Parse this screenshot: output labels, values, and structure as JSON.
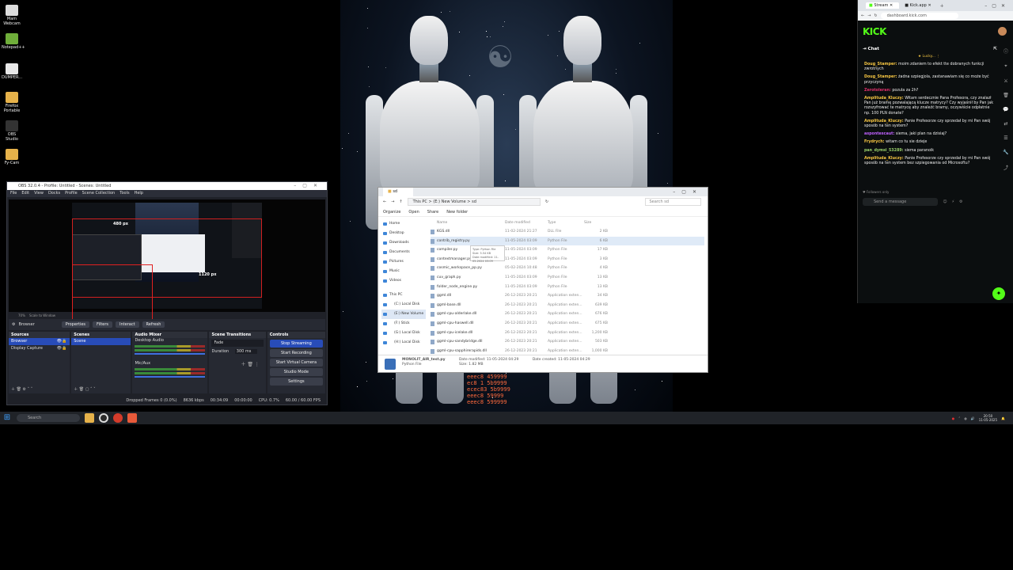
{
  "desktop": {
    "icons": [
      {
        "label": "Mam\nWebcam",
        "color": "#dcdcdc"
      },
      {
        "label": "Notepad++",
        "color": "#6fae3a"
      },
      {
        "label": "DUMPER...",
        "color": "#e8e8e8"
      },
      {
        "label": "Firefox Portable",
        "color": "#e6b24a"
      },
      {
        "label": "OBS Studio",
        "color": "#333333"
      },
      {
        "label": "Fy-Cam",
        "color": "#e6b24a"
      }
    ]
  },
  "wallpaper": {
    "hex_lines": [
      "eeec8 459999",
      "ec8 1 5b9999",
      "ecec83 5b9999",
      "eeec8 59999",
      "eeec8 599999"
    ]
  },
  "obs": {
    "title": "OBS 32.0.4 - Profile: Untitled - Scenes: Untitled",
    "menu": [
      "File",
      "Edit",
      "View",
      "Docks",
      "Profile",
      "Scene Collection",
      "Tools",
      "Help"
    ],
    "dim_top": "480 px",
    "dim_right": "1120 px",
    "zoom_label": "70%",
    "zoom_mode": "Scale to Window",
    "source_bar": {
      "current": "Browser",
      "buttons": [
        "Properties",
        "Filters",
        "Interact",
        "Refresh"
      ]
    },
    "sources": {
      "title": "Sources",
      "items": [
        "Browser",
        "Display Capture"
      ]
    },
    "scenes": {
      "title": "Scenes",
      "items": [
        "Scene"
      ]
    },
    "audio": {
      "title": "Audio Mixer",
      "channels": [
        "Desktop Audio",
        "Mic/Aux"
      ]
    },
    "transitions": {
      "title": "Scene Transitions",
      "type": "Fade",
      "duration_label": "Duration",
      "duration_value": "300 ms"
    },
    "controls": {
      "title": "Controls",
      "buttons": [
        "Stop Streaming",
        "Start Recording",
        "Start Virtual Camera",
        "Studio Mode",
        "Settings"
      ]
    },
    "status": {
      "dropped": "Dropped Frames 0 (0.0%)",
      "bitrate": "8636 kbps",
      "stream_time": "00:34:09",
      "rec_time": "00:00:00",
      "cpu": "CPU: 0.7%",
      "fps": "60.00 / 60.00 FPS"
    }
  },
  "explorer": {
    "tab": "sd",
    "breadcrumb": "This PC  >  (E:) New Volume  >  sd",
    "search_placeholder": "Search sd",
    "toolbar": [
      "Organize",
      "Open",
      "Share",
      "New folder"
    ],
    "nav": [
      "Home",
      "Desktop",
      "Downloads",
      "Documents",
      "Pictures",
      "Music",
      "Videos",
      "This PC",
      "(C:) Local Disk",
      "(E:) New Volume",
      "(F:) Stick",
      "(G:) Local Disk",
      "(H:) Local Disk"
    ],
    "columns": [
      "Name",
      "Date modified",
      "Type",
      "Size"
    ],
    "files": [
      {
        "name": "KGS.dll",
        "date": "11-02-2024 21:27",
        "type": "DLL File",
        "size": "2 KB"
      },
      {
        "name": "contrib_registry.py",
        "date": "11-05-2024 03:09",
        "type": "Python File",
        "size": "6 KB"
      },
      {
        "name": "compiler.py",
        "date": "11-05-2024 03:09",
        "type": "Python File",
        "size": "17 KB"
      },
      {
        "name": "contextmanager.py",
        "date": "11-05-2024 03:09",
        "type": "Python File",
        "size": "3 KB"
      },
      {
        "name": "cosmic_workspace_pp.py",
        "date": "05-02-2024 10:48",
        "type": "Python File",
        "size": "4 KB"
      },
      {
        "name": "cuv_graph.py",
        "date": "11-05-2024 03:09",
        "type": "Python File",
        "size": "13 KB"
      },
      {
        "name": "folder_node_engine.py",
        "date": "11-05-2024 03:09",
        "type": "Python File",
        "size": "13 KB"
      },
      {
        "name": "ggml.dll",
        "date": "26-12-2023 20:21",
        "type": "Application exten...",
        "size": "34 KB"
      },
      {
        "name": "ggml-base.dll",
        "date": "26-12-2023 20:21",
        "type": "Application exten...",
        "size": "639 KB"
      },
      {
        "name": "ggml-cpu-alderlake.dll",
        "date": "26-12-2023 20:21",
        "type": "Application exten...",
        "size": "676 KB"
      },
      {
        "name": "ggml-cpu-haswell.dll",
        "date": "26-12-2023 20:21",
        "type": "Application exten...",
        "size": "675 KB"
      },
      {
        "name": "ggml-cpu-icelake.dll",
        "date": "26-12-2023 20:21",
        "type": "Application exten...",
        "size": "1,200 KB"
      },
      {
        "name": "ggml-cpu-sandybridge.dll",
        "date": "26-12-2023 20:21",
        "type": "Application exten...",
        "size": "503 KB"
      },
      {
        "name": "ggml-cpu-sapphirerapids.dll",
        "date": "26-12-2023 20:21",
        "type": "Application exten...",
        "size": "1,000 KB"
      }
    ],
    "tooltip": [
      "Type: Python File",
      "Size: 5.54 KB",
      "Date modified: 11-05-2024 03:09"
    ],
    "footer": {
      "name": "MONOLIT_AIR_test.py",
      "type": "Python File",
      "date_modified_label": "Date modified:",
      "date_modified": "11-05-2024 04:29",
      "size_label": "Size:",
      "size": "1.82 MB",
      "date_created_label": "Date created:",
      "date_created": "11-05-2024 04:29"
    }
  },
  "browser": {
    "tabs": [
      "Stream",
      "Kick.app"
    ],
    "url": "dashboard.kick.com",
    "logo": "KICK",
    "chat_title": "Chat",
    "pinned": "Lucky...",
    "messages": [
      {
        "user": "Doug_Stamper:",
        "color": "#f5c542",
        "text": "moim zdaniem to efekt tte dobranych funkcji zwrotnych"
      },
      {
        "user": "Doug_Stamper:",
        "color": "#f5c542",
        "text": "żadna szpiegjola, zastanawiam się co może być przyczyną"
      },
      {
        "user": "Zerotoleran:",
        "color": "#e0306b",
        "text": "pozula za 2h?"
      },
      {
        "user": "Amplituda_Kluczy:",
        "color": "#f5c542",
        "text": "Witam serdecznie Pana Profesora, czy znalazł Pan już bramę pozwalającą klucze matrycy? Czy wyjaśnił by Pan jak rozszyfrować te matrycę aby znaleźć bramy, oczywiście odpłatnie np. 100 PLN donate?"
      },
      {
        "user": "Amplituda_Kluczy:",
        "color": "#f5c542",
        "text": "Panie Profesorze czy sprzedał by mi Pan swój sposób na ten system?"
      },
      {
        "user": "aspontescaut:",
        "color": "#c061ff",
        "text": "siema, jaki plan na dzisiaj?"
      },
      {
        "user": "Frydrych:",
        "color": "#f5c542",
        "text": "witam co tu sie dzieje"
      },
      {
        "user": "pan_dymsi_53289:",
        "color": "#9ad06b",
        "text": "siema paranoik"
      },
      {
        "user": "Amplituda_Kluczy:",
        "color": "#f5c542",
        "text": "Panie Profesorze czy sprzedał by mi Pan swój sposób na ten system bez szpiegowania od Microsoftu?"
      }
    ],
    "followers_label": "Followers only",
    "input_placeholder": "Send a message",
    "rail_icons": [
      "info-icon",
      "pin-icon",
      "sword-icon",
      "trash-icon",
      "chat-icon",
      "swap-icon",
      "database-icon",
      "wrench-icon",
      "share-icon"
    ]
  },
  "taskbar": {
    "search_placeholder": "Search",
    "time": "20:50",
    "date": "11-05-2025"
  }
}
